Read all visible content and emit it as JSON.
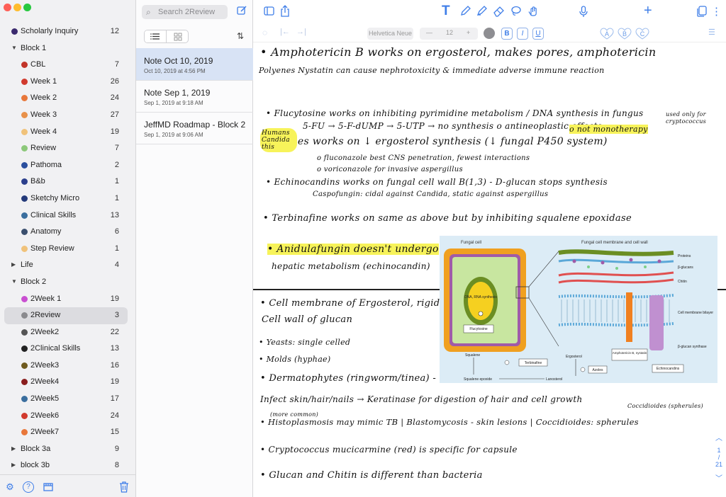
{
  "sidebar": {
    "groups": [
      {
        "label": "Scholarly Inquiry",
        "count": "12",
        "color": "#3b2a6e",
        "kind": "top"
      },
      {
        "label": "Block 1",
        "count": "",
        "kind": "disc-open"
      },
      {
        "label": "CBL",
        "count": "7",
        "color": "#c2352a",
        "kind": "child"
      },
      {
        "label": "Week 1",
        "count": "26",
        "color": "#d13a2e",
        "kind": "child"
      },
      {
        "label": "Week 2",
        "count": "24",
        "color": "#e8773a",
        "kind": "child"
      },
      {
        "label": "Week 3",
        "count": "27",
        "color": "#e8914a",
        "kind": "child"
      },
      {
        "label": "Week 4",
        "count": "19",
        "color": "#f0c27a",
        "kind": "child"
      },
      {
        "label": "Review",
        "count": "7",
        "color": "#8cc87a",
        "kind": "child"
      },
      {
        "label": "Pathoma",
        "count": "2",
        "color": "#2a4f9e",
        "kind": "child"
      },
      {
        "label": "B&b",
        "count": "1",
        "color": "#2b3f8c",
        "kind": "child"
      },
      {
        "label": "Sketchy Micro",
        "count": "1",
        "color": "#243a7a",
        "kind": "child"
      },
      {
        "label": "Clinical Skills",
        "count": "13",
        "color": "#3a6e9e",
        "kind": "child"
      },
      {
        "label": "Anatomy",
        "count": "6",
        "color": "#3a4f6e",
        "kind": "child"
      },
      {
        "label": "Step Review",
        "count": "1",
        "color": "#f0c27a",
        "kind": "child"
      },
      {
        "label": "Life",
        "count": "4",
        "kind": "disc-closed"
      },
      {
        "label": "Block 2",
        "count": "",
        "kind": "disc-open"
      },
      {
        "label": "2Week 1",
        "count": "19",
        "color": "#c94fd1",
        "kind": "child"
      },
      {
        "label": "2Review",
        "count": "3",
        "color": "#8a8a8e",
        "kind": "child-sel"
      },
      {
        "label": "2Week2",
        "count": "22",
        "color": "#555555",
        "kind": "child"
      },
      {
        "label": "2Clinical Skills",
        "count": "13",
        "color": "#222222",
        "kind": "child"
      },
      {
        "label": "2Week3",
        "count": "16",
        "color": "#6e5a1e",
        "kind": "child"
      },
      {
        "label": "2Week4",
        "count": "19",
        "color": "#8a1e1e",
        "kind": "child"
      },
      {
        "label": "2Week5",
        "count": "17",
        "color": "#3a6e9e",
        "kind": "child"
      },
      {
        "label": "2Week6",
        "count": "24",
        "color": "#d13a2e",
        "kind": "child"
      },
      {
        "label": "2Week7",
        "count": "15",
        "color": "#e8773a",
        "kind": "child"
      },
      {
        "label": "Block 3a",
        "count": "9",
        "kind": "disc-closed"
      },
      {
        "label": "block 3b",
        "count": "8",
        "kind": "disc-closed"
      }
    ],
    "footer_icons": [
      "gear-icon",
      "help-icon",
      "store-icon",
      "trash-icon"
    ]
  },
  "notelist": {
    "search_placeholder": "Search 2Review",
    "notes": [
      {
        "title": "Note Oct 10, 2019",
        "date": "Oct 10, 2019 at 4:56 PM",
        "selected": true
      },
      {
        "title": "Note Sep 1, 2019",
        "date": "Sep 1, 2019 at 9:18 AM",
        "selected": false
      },
      {
        "title": "JeffMD Roadmap - Block 2",
        "date": "Sep 1, 2019 at 9:06 AM",
        "selected": false
      }
    ]
  },
  "editor": {
    "font_name": "Helvetica Neue",
    "font_size": "12",
    "format_buttons": [
      "B",
      "I",
      "U"
    ],
    "highlight_buttons": [
      "A",
      "B",
      "C"
    ],
    "page_indicator": {
      "current": "1",
      "total": "21"
    }
  },
  "note": {
    "lines": [
      {
        "text": "• Amphotericin B  works on ergosterol, makes pores, amphotericin",
        "hl": false
      },
      {
        "text": "  Polyenes  Nystatin   can cause nephrotoxicity & immediate adverse immune reaction",
        "hl": false
      },
      {
        "text": "• Flucytosine  works on inhibiting pyrimidine metabolism / DNA synthesis in fungus",
        "hl": false
      },
      {
        "text": "  5-FU → 5-F-dUMP → 5-UTP → no synthesis  o antineoplastic effects",
        "hl": false
      },
      {
        "text": "  o not monotherapy",
        "hl": true
      },
      {
        "text": "• Azoles  works on ↓ ergosterol synthesis (↓ fungal P450 system)",
        "hl": false
      },
      {
        "text": "   o fluconazole best CNS penetration, fewest interactions",
        "hl": false
      },
      {
        "text": "   o voriconazole for invasive aspergillus",
        "hl": false
      },
      {
        "text": "• Echinocandins  works on fungal cell wall  B(1,3) - D-glucan stops synthesis",
        "hl": false
      },
      {
        "text": "   Caspofungin: cidal against Candida, static against aspergillus",
        "hl": false
      },
      {
        "text": "• Terbinafine  works on same as above but by inhibiting squalene epoxidase",
        "hl": false
      },
      {
        "text": "• Anidulafungin doesn't undergo",
        "hl": true
      },
      {
        "text": "  hepatic metabolism (echinocandin)",
        "hl": false
      },
      {
        "text": "• Cell membrane of Ergosterol, rigid",
        "hl": false
      },
      {
        "text": "  Cell wall of glucan",
        "hl": false
      },
      {
        "text": "• Yeasts: single celled",
        "hl": false
      },
      {
        "text": "• Molds (hyphae)",
        "hl": false
      },
      {
        "text": "• Dermatophytes (ringworm/tinea) -",
        "hl": false
      },
      {
        "text": "  Infect skin/hair/nails → Keratinase for digestion of hair and cell growth",
        "hl": false
      },
      {
        "text": "• Histoplasmosis may mimic TB | Blastomycosis - skin lesions | Coccidioides: spherules",
        "hl": false
      },
      {
        "text": "• Cryptococcus mucicarmine (red) is specific for capsule",
        "hl": false
      },
      {
        "text": "• Glucan and Chitin is different than bacteria",
        "hl": false
      }
    ],
    "annotation": "Humans Candida this",
    "side_notes": [
      "(more common)",
      "Coccidioides (spherules)",
      "used only for cryptococcus"
    ]
  },
  "figure": {
    "title_left": "Fungal cell",
    "title_right": "Fungal cell membrane and cell wall",
    "labels": {
      "nucleus": "DNA, RNA synthesis",
      "flucytosine": "Flucytosine",
      "proteins": "Proteins",
      "bglucans": "β-glucans",
      "chitin": "Chitin",
      "bilayer": "Cell membrane bilayer",
      "synthase": "β-glucan synthase",
      "squalene": "Squalene",
      "terbinafine": "Terbinafine",
      "epoxide": "Squalene epoxide",
      "lanosterol": "Lanosterol",
      "ergosterol": "Ergosterol",
      "azoles": "Azoles",
      "ampho": "Amphotericin B, nystatin",
      "echino": "Echinocandins"
    }
  }
}
